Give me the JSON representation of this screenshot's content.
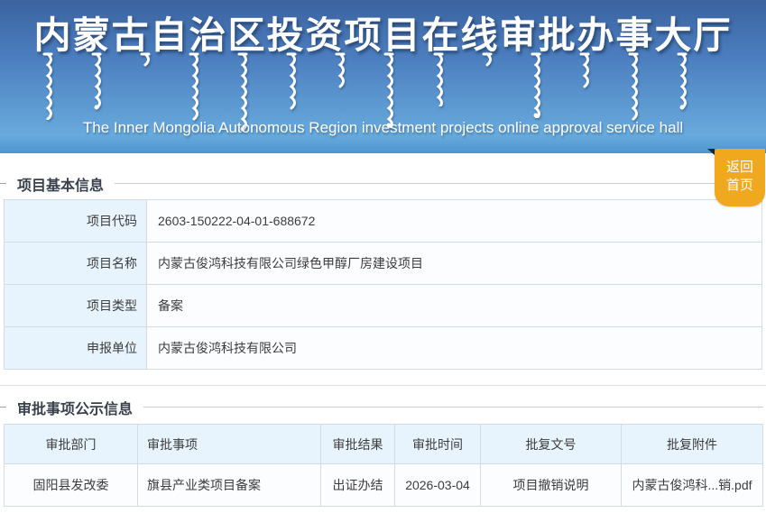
{
  "header": {
    "title": "内蒙古自治区投资项目在线审批办事大厅",
    "subtitle": "The Inner Mongolia Autonomous Region investment projects online approval service hall",
    "gradient_top_color": "#3b639f",
    "gradient_bottom_color": "#5f9fd6"
  },
  "return_button": {
    "label_line1": "返回",
    "label_line2": "首页",
    "bg_color": "#f0a81f"
  },
  "basic_info": {
    "section_title": "项目基本信息",
    "fields": [
      {
        "label": "项目代码",
        "value": "2603-150222-04-01-688672"
      },
      {
        "label": "项目名称",
        "value": "内蒙古俊鸿科技有限公司绿色甲醇厂房建设项目"
      },
      {
        "label": "项目类型",
        "value": "备案"
      },
      {
        "label": "申报单位",
        "value": "内蒙古俊鸿科技有限公司"
      }
    ]
  },
  "approval_info": {
    "section_title": "审批事项公示信息",
    "columns": [
      "审批部门",
      "审批事项",
      "审批结果",
      "审批时间",
      "批复文号",
      "批复附件"
    ],
    "rows": [
      [
        "固阳县发改委",
        "旗县产业类项目备案",
        "出证办结",
        "2026-03-04",
        "项目撤销说明",
        "内蒙古俊鸿科...销.pdf"
      ]
    ]
  },
  "colors": {
    "table_header_bg": "#e8f4fd",
    "table_border": "#d3dce2",
    "section_title_text": "#39414d",
    "body_text": "#3c3c3c"
  }
}
